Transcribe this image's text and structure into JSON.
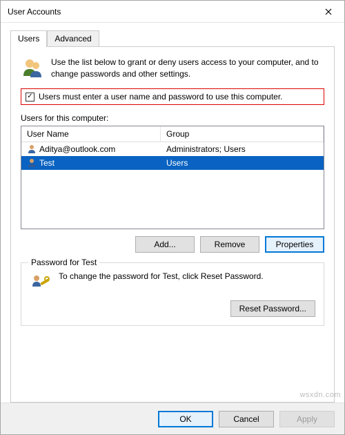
{
  "window": {
    "title": "User Accounts"
  },
  "tabs": {
    "users": "Users",
    "advanced": "Advanced"
  },
  "intro": {
    "text": "Use the list below to grant or deny users access to your computer, and to change passwords and other settings."
  },
  "checkbox": {
    "label": "Users must enter a user name and password to use this computer.",
    "checked": "✓"
  },
  "list": {
    "label": "Users for this computer:",
    "headers": {
      "name": "User Name",
      "group": "Group"
    },
    "rows": [
      {
        "name": "Aditya@outlook.com",
        "group": "Administrators; Users",
        "selected": false
      },
      {
        "name": "Test",
        "group": "Users",
        "selected": true
      }
    ]
  },
  "buttons": {
    "add": "Add...",
    "remove": "Remove",
    "properties": "Properties",
    "reset": "Reset Password...",
    "ok": "OK",
    "cancel": "Cancel",
    "apply": "Apply"
  },
  "password_group": {
    "legend": "Password for Test",
    "text": "To change the password for Test, click Reset Password."
  },
  "watermark": "wsxdn.com"
}
